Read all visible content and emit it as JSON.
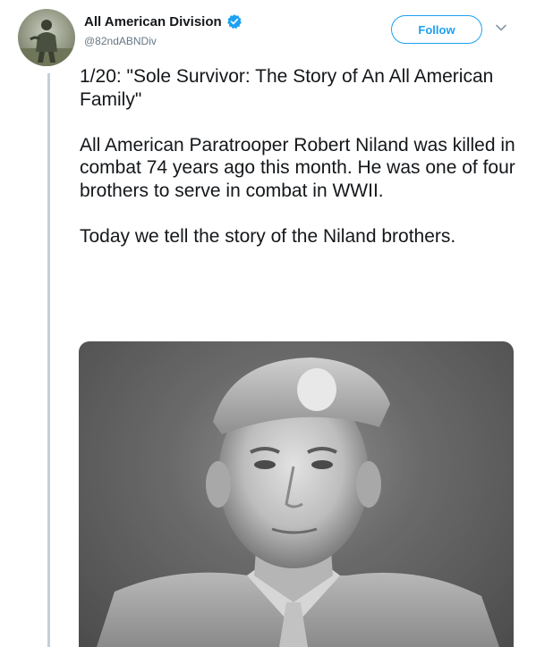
{
  "account": {
    "display_name": "All American Division",
    "handle": "@82ndABNDiv",
    "verified": true
  },
  "actions": {
    "follow_label": "Follow",
    "more_icon": "chevron-down-icon"
  },
  "tweet": {
    "paragraphs": [
      "1/20: \"Sole Survivor: The Story of An All American Family\"",
      "All American Paratrooper Robert Niland was killed in combat 74 years ago this month.  He was one of four brothers to serve in combat in WWII.",
      "Today we tell the story of the Niland brothers."
    ]
  },
  "media": {
    "type": "black-and-white portrait photo"
  },
  "colors": {
    "accent": "#1da1f2",
    "text": "#14171a",
    "muted": "#657786",
    "thread_line": "#c4cfd6"
  }
}
